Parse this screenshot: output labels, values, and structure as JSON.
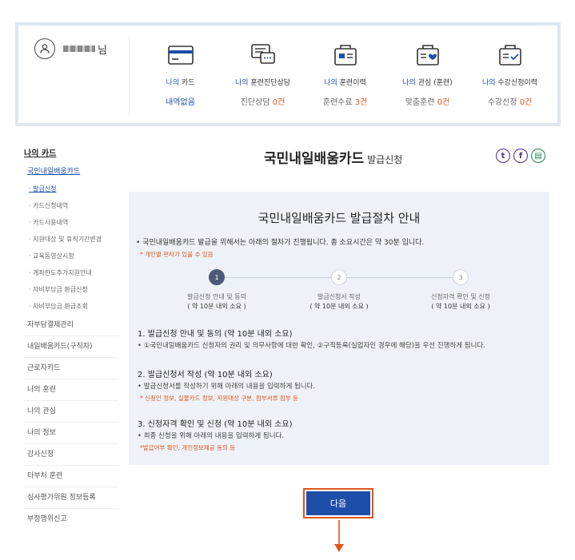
{
  "user": {
    "suffix": "님"
  },
  "summary": {
    "items": [
      {
        "icon": "card-icon",
        "label_hl": "나의",
        "label": " 카드",
        "value": "내역없음",
        "value_num": "",
        "value_suffix": ""
      },
      {
        "icon": "consult-chat-icon",
        "label_hl": "나의",
        "label": " 훈련진단상담",
        "value": "진단상담 ",
        "value_num": "0건",
        "value_suffix": ""
      },
      {
        "icon": "training-history-icon",
        "label_hl": "나의",
        "label": " 훈련이력",
        "value": "훈련수료 ",
        "value_num": "3건",
        "value_suffix": ""
      },
      {
        "icon": "interest-heart-icon",
        "label_hl": "나의",
        "label": " 관심 (훈련)",
        "value": "맞춤훈련 ",
        "value_num": "0건",
        "value_suffix": ""
      },
      {
        "icon": "course-check-icon",
        "label_hl": "나의",
        "label": " 수강신청이력",
        "value": "수강신청 ",
        "value_num": "0건",
        "value_suffix": ""
      }
    ]
  },
  "sidebar": {
    "top": "나의 카드",
    "sub": "국민내일배움카드",
    "items": [
      "· 발급신청",
      "· 카드신청내역",
      "· 카드사용내역",
      "· 지원대상 및 휴직기간변경",
      "· 교육동영상시청",
      "· 계좌한도추가지원안내",
      "· 자비부담금 환급신청",
      "· 자비부담금 환급조회"
    ],
    "mains": [
      "자부담결제관리",
      "내일배움카드(구직자)",
      "근로자카드",
      "나의 훈련",
      "나의 관심",
      "나의 정보",
      "강사신청",
      "타부처 훈련",
      "심사평가위원 정보등록",
      "부정행위신고"
    ]
  },
  "title": {
    "main": "국민내일배움카드",
    "sub": "발급신청"
  },
  "info": {
    "title": "국민내일배움카드 발급절차 안내",
    "intro": "• 국민내일배움카드 발급을 위해서는 아래의 절차가 진행됩니다. 총 소요시간은 약 30분 입니다.",
    "intro_note": "* 개인별 편차가 있을 수 있음",
    "steps": [
      {
        "num": "1",
        "title": "발급신청 안내 및 동의",
        "dur": "( 약 10분 내외 소요 )"
      },
      {
        "num": "2",
        "title": "발급신청서 작성",
        "dur": "( 약 10분 내외 소요 )"
      },
      {
        "num": "3",
        "title": "신청자격 확인 및 신청",
        "dur": "( 약 10분 내외 소요 )"
      }
    ],
    "sections": [
      {
        "h": "1. 발급신청 안내 및 동의 (약 10분 내외 소요)",
        "b": "• ①국민내일배움카드 신청자의 권리 및 의무사항에 대한 확인, ②구직등록(실업자인 경우에 해당)을 우선 진행하게 됩니다.",
        "n": ""
      },
      {
        "h": "2. 발급신청서 작성 (약 10분 내외 소요)",
        "b": "• 발급신청서를 작성하기 위해 아래의 내용을 입력하게 됩니다.",
        "n": "* 신청인 정보, 실물카드 정보, 지원대상 구분, 첨부서류 첨부 등"
      },
      {
        "h": "3. 신청자격 확인 및 신청 (약 10분 내외 소요)",
        "b": "• 최종 신청을 위해 아래의 내용을 입력하게 됩니다.",
        "n": "*발급여부 확인, 개인정보제공 동의 등"
      }
    ]
  },
  "next": {
    "label": "다음"
  },
  "colors": {
    "accent": "#1e4ea8",
    "highlight": "#e0541b",
    "panel": "#eef2f8"
  }
}
